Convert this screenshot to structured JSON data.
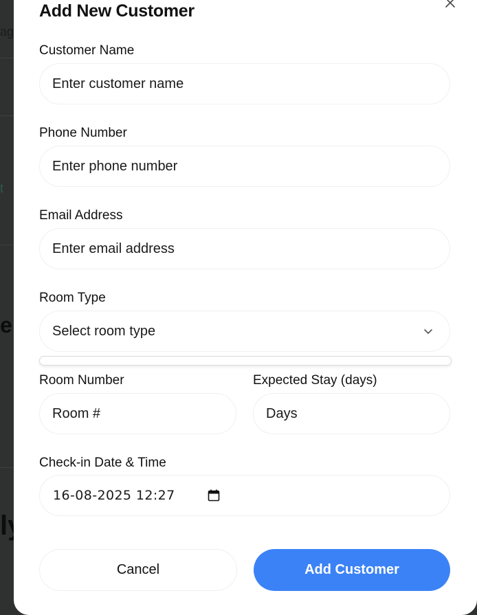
{
  "backdrop": {
    "frag1": "ag",
    "frag2": "t",
    "frag3": "e",
    "frag4": "ly"
  },
  "modal": {
    "title": "Add New Customer",
    "close_icon": "close-icon",
    "fields": {
      "customer_name": {
        "label": "Customer Name",
        "placeholder": "Enter customer name"
      },
      "phone": {
        "label": "Phone Number",
        "placeholder": "Enter phone number"
      },
      "email": {
        "label": "Email Address",
        "placeholder": "Enter email address"
      },
      "room_type": {
        "label": "Room Type",
        "selected": "Select room type"
      },
      "room_number": {
        "label": "Room Number",
        "placeholder": "Room #"
      },
      "expected_stay": {
        "label": "Expected Stay (days)",
        "placeholder": "Days"
      },
      "checkin": {
        "label": "Check-in Date & Time",
        "value": "16-08-2025 12:27"
      }
    },
    "buttons": {
      "cancel": "Cancel",
      "submit": "Add Customer"
    },
    "colors": {
      "primary": "#3b82f6",
      "backdrop": "#2f3130"
    }
  }
}
